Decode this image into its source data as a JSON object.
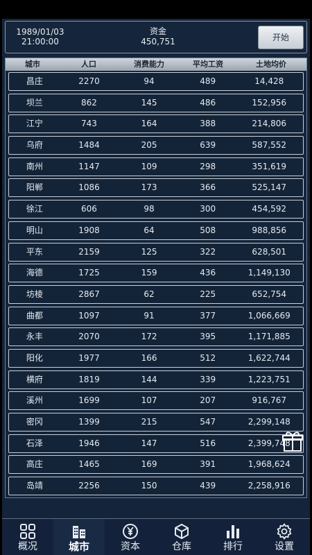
{
  "header": {
    "date": "1989/01/03",
    "time": "21:00:00",
    "fund_label": "资金",
    "fund_value": "450,751",
    "start_label": "开始"
  },
  "table": {
    "columns": [
      "城市",
      "人口",
      "消费能力",
      "平均工资",
      "土地均价"
    ],
    "rows": [
      [
        "昌庄",
        "2270",
        "94",
        "489",
        "14,428"
      ],
      [
        "坝兰",
        "862",
        "145",
        "486",
        "152,956"
      ],
      [
        "江宁",
        "743",
        "164",
        "388",
        "214,806"
      ],
      [
        "乌府",
        "1484",
        "205",
        "639",
        "587,552"
      ],
      [
        "南州",
        "1147",
        "109",
        "298",
        "351,619"
      ],
      [
        "阳郸",
        "1086",
        "173",
        "366",
        "525,147"
      ],
      [
        "徐江",
        "606",
        "98",
        "300",
        "454,592"
      ],
      [
        "明山",
        "1908",
        "64",
        "508",
        "988,856"
      ],
      [
        "平东",
        "2159",
        "125",
        "322",
        "628,501"
      ],
      [
        "海德",
        "1725",
        "159",
        "436",
        "1,149,130"
      ],
      [
        "坊棱",
        "2867",
        "62",
        "225",
        "652,754"
      ],
      [
        "曲都",
        "1097",
        "91",
        "377",
        "1,066,669"
      ],
      [
        "永丰",
        "2070",
        "172",
        "395",
        "1,171,885"
      ],
      [
        "阳化",
        "1977",
        "166",
        "512",
        "1,622,744"
      ],
      [
        "横府",
        "1819",
        "144",
        "339",
        "1,223,751"
      ],
      [
        "溪州",
        "1699",
        "107",
        "207",
        "916,767"
      ],
      [
        "密冈",
        "1399",
        "215",
        "547",
        "2,299,148"
      ],
      [
        "石泽",
        "1946",
        "147",
        "516",
        "2,399,748"
      ],
      [
        "高庄",
        "1465",
        "169",
        "391",
        "1,968,624"
      ],
      [
        "岛靖",
        "2256",
        "150",
        "439",
        "2,258,916"
      ]
    ]
  },
  "gift_icon": "gift-icon",
  "nav": {
    "items": [
      {
        "label": "概况",
        "icon": "overview-grid-icon"
      },
      {
        "label": "城市",
        "icon": "city-buildings-icon",
        "active": true
      },
      {
        "label": "资本",
        "icon": "yen-coin-icon"
      },
      {
        "label": "仓库",
        "icon": "warehouse-box-icon"
      },
      {
        "label": "排行",
        "icon": "ranking-bars-icon"
      },
      {
        "label": "设置",
        "icon": "settings-gear-icon"
      }
    ]
  },
  "colors": {
    "background": "#14243a",
    "row_border": "#c9d0d8",
    "header_gradient_top": "#cfd5dc",
    "header_gradient_bottom": "#9aa4af"
  }
}
